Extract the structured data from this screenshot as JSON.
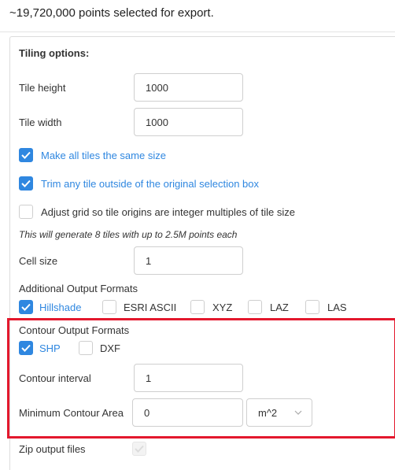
{
  "header": {
    "text": "~19,720,000 points selected for export."
  },
  "tiling": {
    "title": "Tiling options:",
    "tile_height_label": "Tile height",
    "tile_height_value": "1000",
    "tile_width_label": "Tile width",
    "tile_width_value": "1000",
    "same_size_label": "Make all tiles the same size",
    "trim_label": "Trim any tile outside of the original selection box",
    "adjust_grid_label": "Adjust grid so tile origins are integer multiples of tile size",
    "info_text": "This will generate 8 tiles with up to 2.5M points each",
    "cell_size_label": "Cell size",
    "cell_size_value": "1"
  },
  "additional_formats": {
    "title": "Additional Output Formats",
    "options": [
      {
        "label": "Hillshade",
        "checked": true
      },
      {
        "label": "ESRI ASCII",
        "checked": false
      },
      {
        "label": "XYZ",
        "checked": false
      },
      {
        "label": "LAZ",
        "checked": false
      },
      {
        "label": "LAS",
        "checked": false
      }
    ]
  },
  "contour": {
    "title": "Contour Output Formats",
    "options": [
      {
        "label": "SHP",
        "checked": true
      },
      {
        "label": "DXF",
        "checked": false
      }
    ],
    "interval_label": "Contour interval",
    "interval_value": "1",
    "min_area_label": "Minimum Contour Area",
    "min_area_value": "0",
    "min_area_unit": "m^2"
  },
  "zip": {
    "label": "Zip output files",
    "checked": true
  },
  "colors": {
    "accent": "#2f87e0",
    "highlight": "#e3182d"
  }
}
